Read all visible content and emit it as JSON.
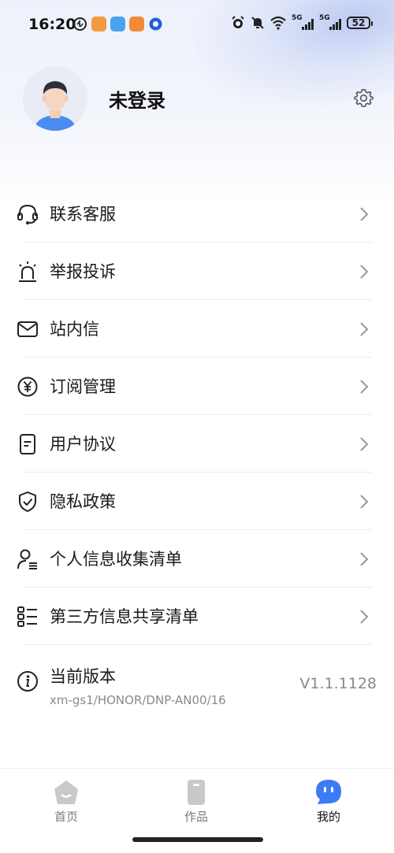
{
  "status_bar": {
    "time": "16:20",
    "network_left": "5G",
    "network_right": "5G",
    "battery": "52"
  },
  "profile": {
    "username": "未登录"
  },
  "menu": {
    "items": [
      {
        "label": "联系客服",
        "icon": "headset-icon"
      },
      {
        "label": "举报投诉",
        "icon": "alarm-light-icon"
      },
      {
        "label": "站内信",
        "icon": "mail-icon"
      },
      {
        "label": "订阅管理",
        "icon": "yen-circle-icon"
      },
      {
        "label": "用户协议",
        "icon": "document-icon"
      },
      {
        "label": "隐私政策",
        "icon": "shield-check-icon"
      },
      {
        "label": "个人信息收集清单",
        "icon": "user-list-icon"
      },
      {
        "label": "第三方信息共享清单",
        "icon": "list-icon"
      }
    ],
    "version": {
      "label": "当前版本",
      "detail": "xm-gs1/HONOR/DNP-AN00/16",
      "value": "V1.1.1128"
    }
  },
  "tabs": [
    {
      "label": "首页",
      "icon": "home-icon",
      "active": false
    },
    {
      "label": "作品",
      "icon": "works-icon",
      "active": false
    },
    {
      "label": "我的",
      "icon": "profile-chat-icon",
      "active": true
    }
  ],
  "colors": {
    "accent": "#3d7bf6",
    "muted_text": "#8a8a8a"
  }
}
